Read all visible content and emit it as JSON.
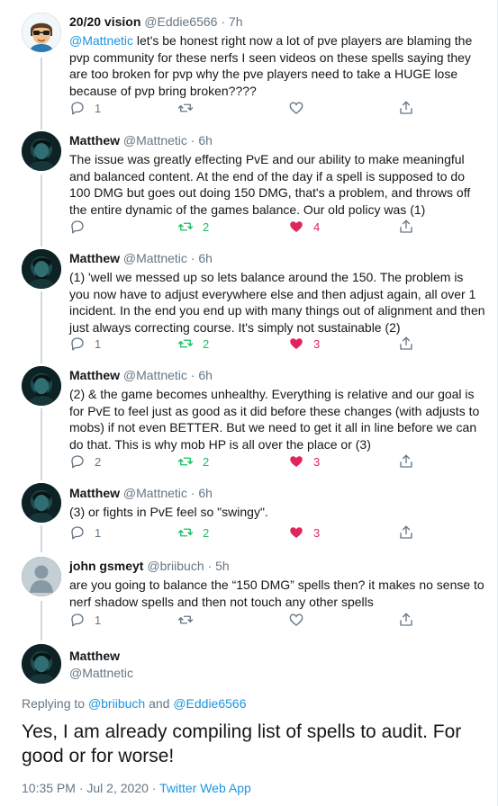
{
  "colors": {
    "link": "#1b95e0",
    "muted": "#657786",
    "retweet": "#17bf63",
    "like": "#e0245e"
  },
  "tweets": [
    {
      "name": "20/20 vision",
      "handle": "@Eddie6566",
      "dot": "·",
      "time": "7h",
      "mention": "@Mattnetic",
      "text": " let's be honest right now a lot of pve players are blaming the pvp community for these nerfs I seen videos on these spells saying they are too broken for pvp why the pve players need to take a HUGE lose because of pvp bring broken????",
      "reply_count": "1",
      "retweet_count": "",
      "like_count": ""
    },
    {
      "name": "Matthew",
      "handle": "@Mattnetic",
      "dot": "·",
      "time": "6h",
      "text": "The issue was greatly effecting PvE and our ability to make meaningful and balanced content. At the end of the day if a spell is supposed to do 100 DMG but goes out doing 150 DMG, that's a problem, and throws off the entire dynamic of the games balance. Our old policy was (1)",
      "reply_count": "",
      "retweet_count": "2",
      "like_count": "4"
    },
    {
      "name": "Matthew",
      "handle": "@Mattnetic",
      "dot": "·",
      "time": "6h",
      "text": "(1) 'well we messed up so lets balance around the 150. The problem is you now have to adjust everywhere else and then adjust again, all over 1 incident. In the end you end up with many things out of alignment and then just always correcting course. It's simply not sustainable (2)",
      "reply_count": "1",
      "retweet_count": "2",
      "like_count": "3"
    },
    {
      "name": "Matthew",
      "handle": "@Mattnetic",
      "dot": "·",
      "time": "6h",
      "text": "(2) & the game becomes unhealthy. Everything is relative and our goal is for PvE to feel just as good as it did before these changes (with adjusts to mobs) if not even BETTER. But we need to get it all in line before we can do that. This is why mob HP is all over the place or (3)",
      "reply_count": "2",
      "retweet_count": "2",
      "like_count": "3"
    },
    {
      "name": "Matthew",
      "handle": "@Mattnetic",
      "dot": "·",
      "time": "6h",
      "text": "(3) or fights in PvE feel so \"swingy\".",
      "reply_count": "1",
      "retweet_count": "2",
      "like_count": "3"
    },
    {
      "name": "john gsmeyt",
      "handle": "@briibuch",
      "dot": "·",
      "time": "5h",
      "text": "are you going to balance the “150 DMG” spells then? it makes no sense to nerf shadow spells and then not touch any other spells",
      "reply_count": "1",
      "retweet_count": "",
      "like_count": ""
    }
  ],
  "focused": {
    "name": "Matthew",
    "handle": "@Mattnetic",
    "replying_prefix": "Replying to ",
    "replying_to_1": "@briibuch",
    "replying_and": " and ",
    "replying_to_2": "@Eddie6566",
    "text": "Yes, I am already compiling list of spells to audit. For good or for worse!",
    "time": "10:35 PM",
    "dot": " · ",
    "date": "Jul 2, 2020",
    "dot2": " · ",
    "source": "Twitter Web App"
  },
  "icons": [
    "reply-icon",
    "retweet-icon",
    "like-icon",
    "share-icon"
  ]
}
